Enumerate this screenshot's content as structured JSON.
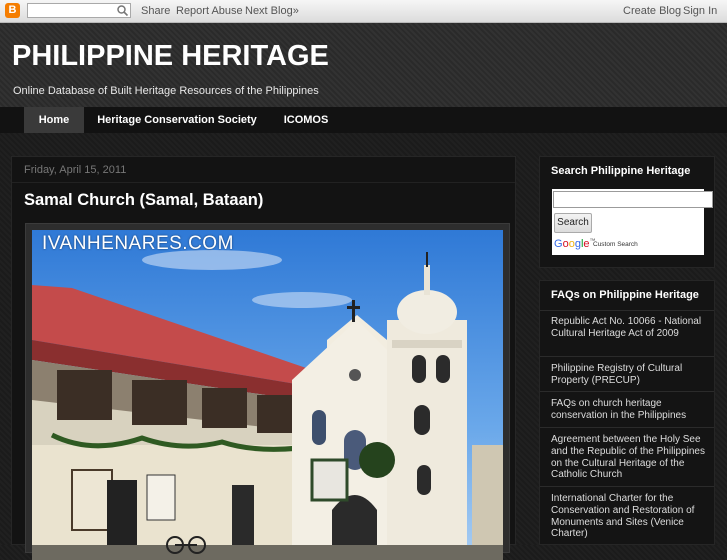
{
  "navbar": {
    "logo_letter": "B",
    "search_placeholder": "",
    "share": "Share",
    "report_abuse": "Report Abuse",
    "next_blog": "Next Blog»",
    "create_blog": "Create Blog",
    "sign_in": "Sign In"
  },
  "header": {
    "title": "PHILIPPINE HERITAGE",
    "description": "Online Database of Built Heritage Resources of the Philippines"
  },
  "tabs": [
    {
      "label": "Home",
      "active": true
    },
    {
      "label": "Heritage Conservation Society",
      "active": false
    },
    {
      "label": "ICOMOS",
      "active": false
    }
  ],
  "post": {
    "date": "Friday, April 15, 2011",
    "title": "Samal Church (Samal, Bataan)",
    "watermark": "IVANHENARES.COM"
  },
  "sidebar": {
    "search_widget": {
      "title": "Search Philippine Heritage",
      "button": "Search",
      "google": [
        "G",
        "o",
        "o",
        "g",
        "l",
        "e"
      ],
      "trademark": "™",
      "cse_label": "Custom Search"
    },
    "faq_widget": {
      "title": "FAQs on Philippine Heritage",
      "items": [
        "Republic Act No. 10066 - National Cultural Heritage Act of 2009",
        "Philippine Registry of Cultural Property (PRECUP)",
        "FAQs on church heritage conservation in the Philippines",
        "Agreement between the Holy See and the Republic of the Philippines on the Cultural Heritage of the Catholic Church",
        "International Charter for the Conservation and Restoration of Monuments and Sites (Venice Charter)"
      ]
    }
  },
  "colors": {
    "background": "#1b1b1b",
    "header": "#2a2a2a",
    "tab_bar": "#121212",
    "tab_active": "#3a3a3a",
    "blogger_orange": "#f57d00"
  }
}
